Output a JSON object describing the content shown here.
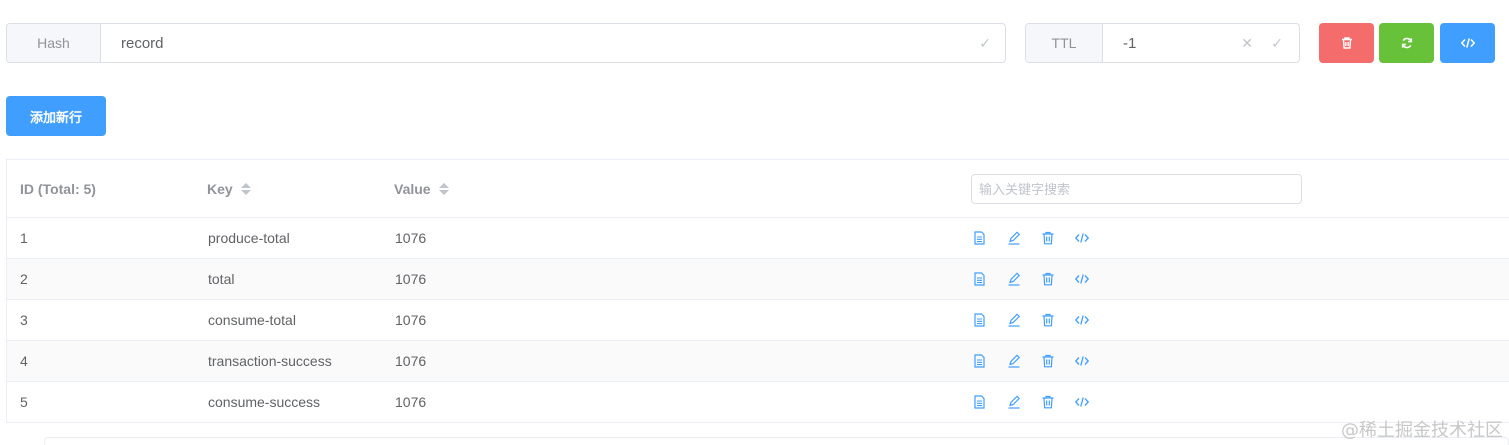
{
  "key_bar": {
    "type_label": "Hash",
    "key_value": "record",
    "ttl_label": "TTL",
    "ttl_value": "-1"
  },
  "actions": {
    "add_row_label": "添加新行",
    "colors": {
      "delete": "#f56c6c",
      "refresh": "#67c23a",
      "code": "#409eff"
    }
  },
  "table": {
    "columns": {
      "id": "ID (Total: 5)",
      "key": "Key",
      "value": "Value"
    },
    "search_placeholder": "输入关键字搜索",
    "rows": [
      {
        "id": "1",
        "key": "produce-total",
        "value": "1076"
      },
      {
        "id": "2",
        "key": "total",
        "value": "1076"
      },
      {
        "id": "3",
        "key": "consume-total",
        "value": "1076"
      },
      {
        "id": "4",
        "key": "transaction-success",
        "value": "1076"
      },
      {
        "id": "5",
        "key": "consume-success",
        "value": "1076"
      }
    ],
    "row_actions": [
      "document-icon",
      "edit-icon",
      "delete-icon",
      "code-icon"
    ]
  },
  "watermark": "@稀土掘金技术社区"
}
